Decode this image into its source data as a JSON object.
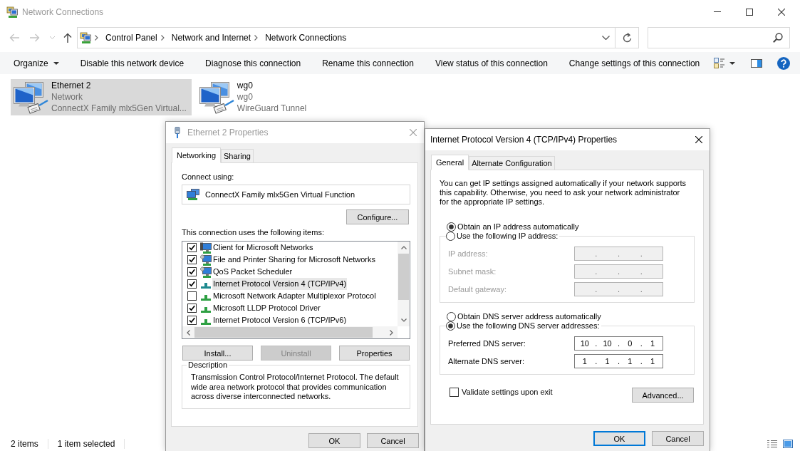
{
  "window": {
    "title": "Network Connections",
    "active": false
  },
  "navigation": {
    "back": {
      "disabled": true
    },
    "forward": {
      "disabled": true
    },
    "up": {
      "disabled": false
    }
  },
  "address_bar": {
    "breadcrumbs": [
      "Control Panel",
      "Network and Internet",
      "Network Connections"
    ]
  },
  "toolbar": {
    "items": [
      {
        "label": "Organize",
        "kind": "menu"
      },
      {
        "label": "Disable this network device",
        "kind": "command"
      },
      {
        "label": "Diagnose this connection",
        "kind": "command"
      },
      {
        "label": "Rename this connection",
        "kind": "command"
      },
      {
        "label": "View status of this connection",
        "kind": "command"
      },
      {
        "label": "Change settings of this connection",
        "kind": "command"
      }
    ]
  },
  "connections": [
    {
      "name": "Ethernet 2",
      "status": "Network",
      "device": "ConnectX Family mlx5Gen Virtual...",
      "selected": true
    },
    {
      "name": "wg0",
      "status": "wg0",
      "device": "WireGuard Tunnel",
      "selected": false
    }
  ],
  "status_bar": {
    "item_count": "2 items",
    "selection": "1 item selected"
  },
  "ethernet_properties": {
    "title": "Ethernet 2 Properties",
    "active": false,
    "tabs": [
      {
        "label": "Networking",
        "selected": true
      },
      {
        "label": "Sharing",
        "selected": false
      }
    ],
    "connect_using_label": "Connect using:",
    "adapter": "ConnectX Family mlx5Gen Virtual Function",
    "configure_button": "Configure...",
    "items_label": "This connection uses the following items:",
    "items": [
      {
        "label": "Client for Microsoft Networks",
        "kind": "client",
        "checked": true,
        "selected": false
      },
      {
        "label": "File and Printer Sharing for Microsoft Networks",
        "kind": "service",
        "checked": true,
        "selected": false
      },
      {
        "label": "QoS Packet Scheduler",
        "kind": "service",
        "checked": true,
        "selected": false
      },
      {
        "label": "Internet Protocol Version 4 (TCP/IPv4)",
        "kind": "protocol",
        "checked": true,
        "selected": true
      },
      {
        "label": "Microsoft Network Adapter Multiplexor Protocol",
        "kind": "protocol",
        "checked": false,
        "selected": false
      },
      {
        "label": "Microsoft LLDP Protocol Driver",
        "kind": "protocol",
        "checked": true,
        "selected": false
      },
      {
        "label": "Internet Protocol Version 6 (TCP/IPv6)",
        "kind": "protocol",
        "checked": true,
        "selected": false
      }
    ],
    "item_buttons": [
      {
        "label": "Install...",
        "disabled": false
      },
      {
        "label": "Uninstall",
        "disabled": true
      },
      {
        "label": "Properties",
        "disabled": false
      }
    ],
    "description": {
      "heading": "Description",
      "text": "Transmission Control Protocol/Internet Protocol. The default\nwide area network protocol that provides communication\nacross diverse interconnected networks."
    },
    "buttons": [
      {
        "label": "OK",
        "default": false
      },
      {
        "label": "Cancel",
        "default": false
      }
    ]
  },
  "ipv4_properties": {
    "title": "Internet Protocol Version 4 (TCP/IPv4) Properties",
    "active": true,
    "tabs": [
      {
        "label": "General",
        "selected": true
      },
      {
        "label": "Alternate Configuration",
        "selected": false
      }
    ],
    "intro": "You can get IP settings assigned automatically if your network supports\nthis capability. Otherwise, you need to ask your network administrator\nfor the appropriate IP settings.",
    "ip_auto": {
      "label": "Obtain an IP address automatically",
      "selected": true
    },
    "ip_manual": {
      "label": "Use the following IP address:",
      "selected": false,
      "fields": [
        {
          "label": "IP address:",
          "separator": ".",
          "disabled": true
        },
        {
          "label": "Subnet mask:",
          "separator": ".",
          "disabled": true
        },
        {
          "label": "Default gateway:",
          "separator": ".",
          "disabled": true
        }
      ]
    },
    "dns_auto": {
      "label": "Obtain DNS server address automatically",
      "selected": false
    },
    "dns_manual": {
      "label": "Use the following DNS server addresses:",
      "selected": true,
      "fields": [
        {
          "label": "Preferred DNS server:",
          "octets": [
            "10",
            "10",
            "0",
            "1"
          ],
          "separator": ".",
          "disabled": false
        },
        {
          "label": "Alternate DNS server:",
          "octets": [
            "1",
            "1",
            "1",
            "1"
          ],
          "separator": ".",
          "disabled": false
        }
      ]
    },
    "validate": {
      "label": "Validate settings upon exit",
      "checked": false
    },
    "advanced_button": "Advanced...",
    "buttons": [
      {
        "label": "OK",
        "default": true
      },
      {
        "label": "Cancel",
        "default": false
      }
    ]
  }
}
